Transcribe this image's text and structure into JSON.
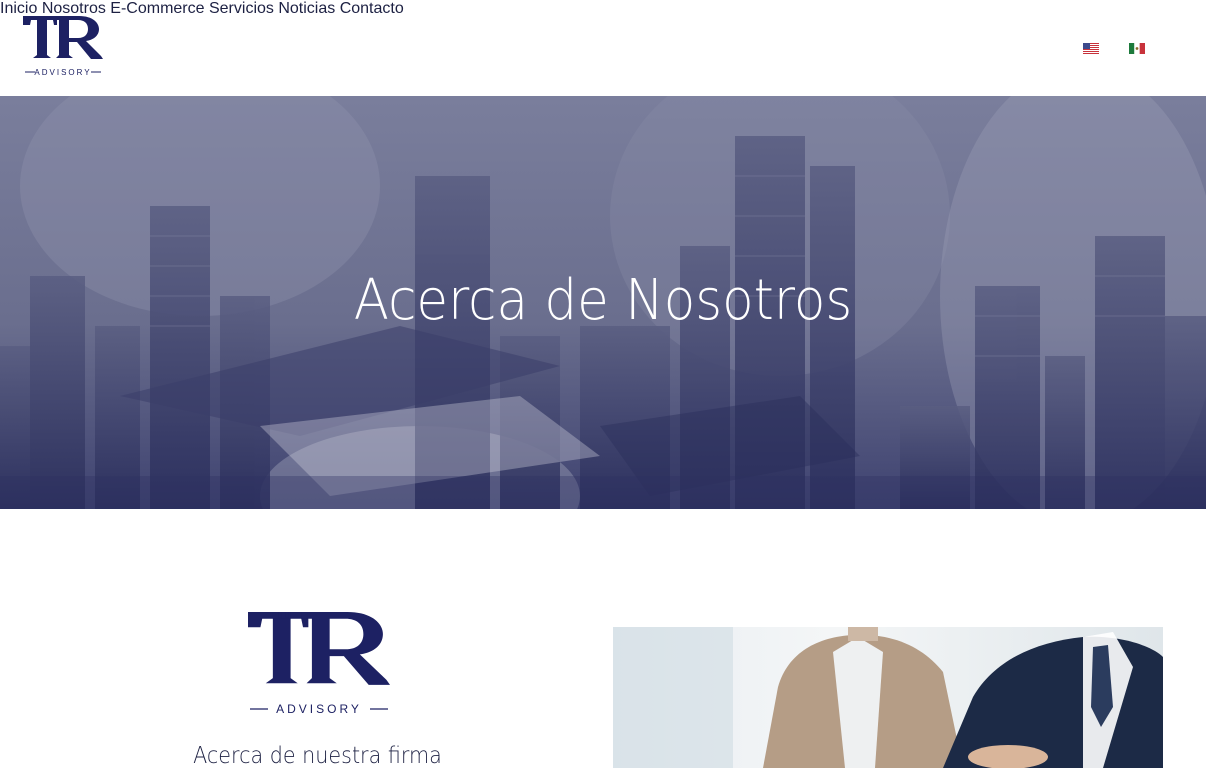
{
  "brand": {
    "logo_text": "TR",
    "logo_subtitle": "ADVISORY",
    "primary_color": "#1d2163",
    "text_color": "#2a2f4e"
  },
  "nav": {
    "items": [
      {
        "label": "Inicio"
      },
      {
        "label": "Nosotros"
      },
      {
        "label": "E-Commerce"
      },
      {
        "label": "Servicios"
      },
      {
        "label": "Noticias"
      },
      {
        "label": "Contacto"
      }
    ],
    "languages": [
      {
        "icon": "us-flag-icon"
      },
      {
        "icon": "mexico-flag-icon"
      }
    ]
  },
  "hero": {
    "title": "Acerca de Nosotros",
    "overlay_color": "#4b5080"
  },
  "about": {
    "heading": "Acerca de nuestra firma"
  }
}
